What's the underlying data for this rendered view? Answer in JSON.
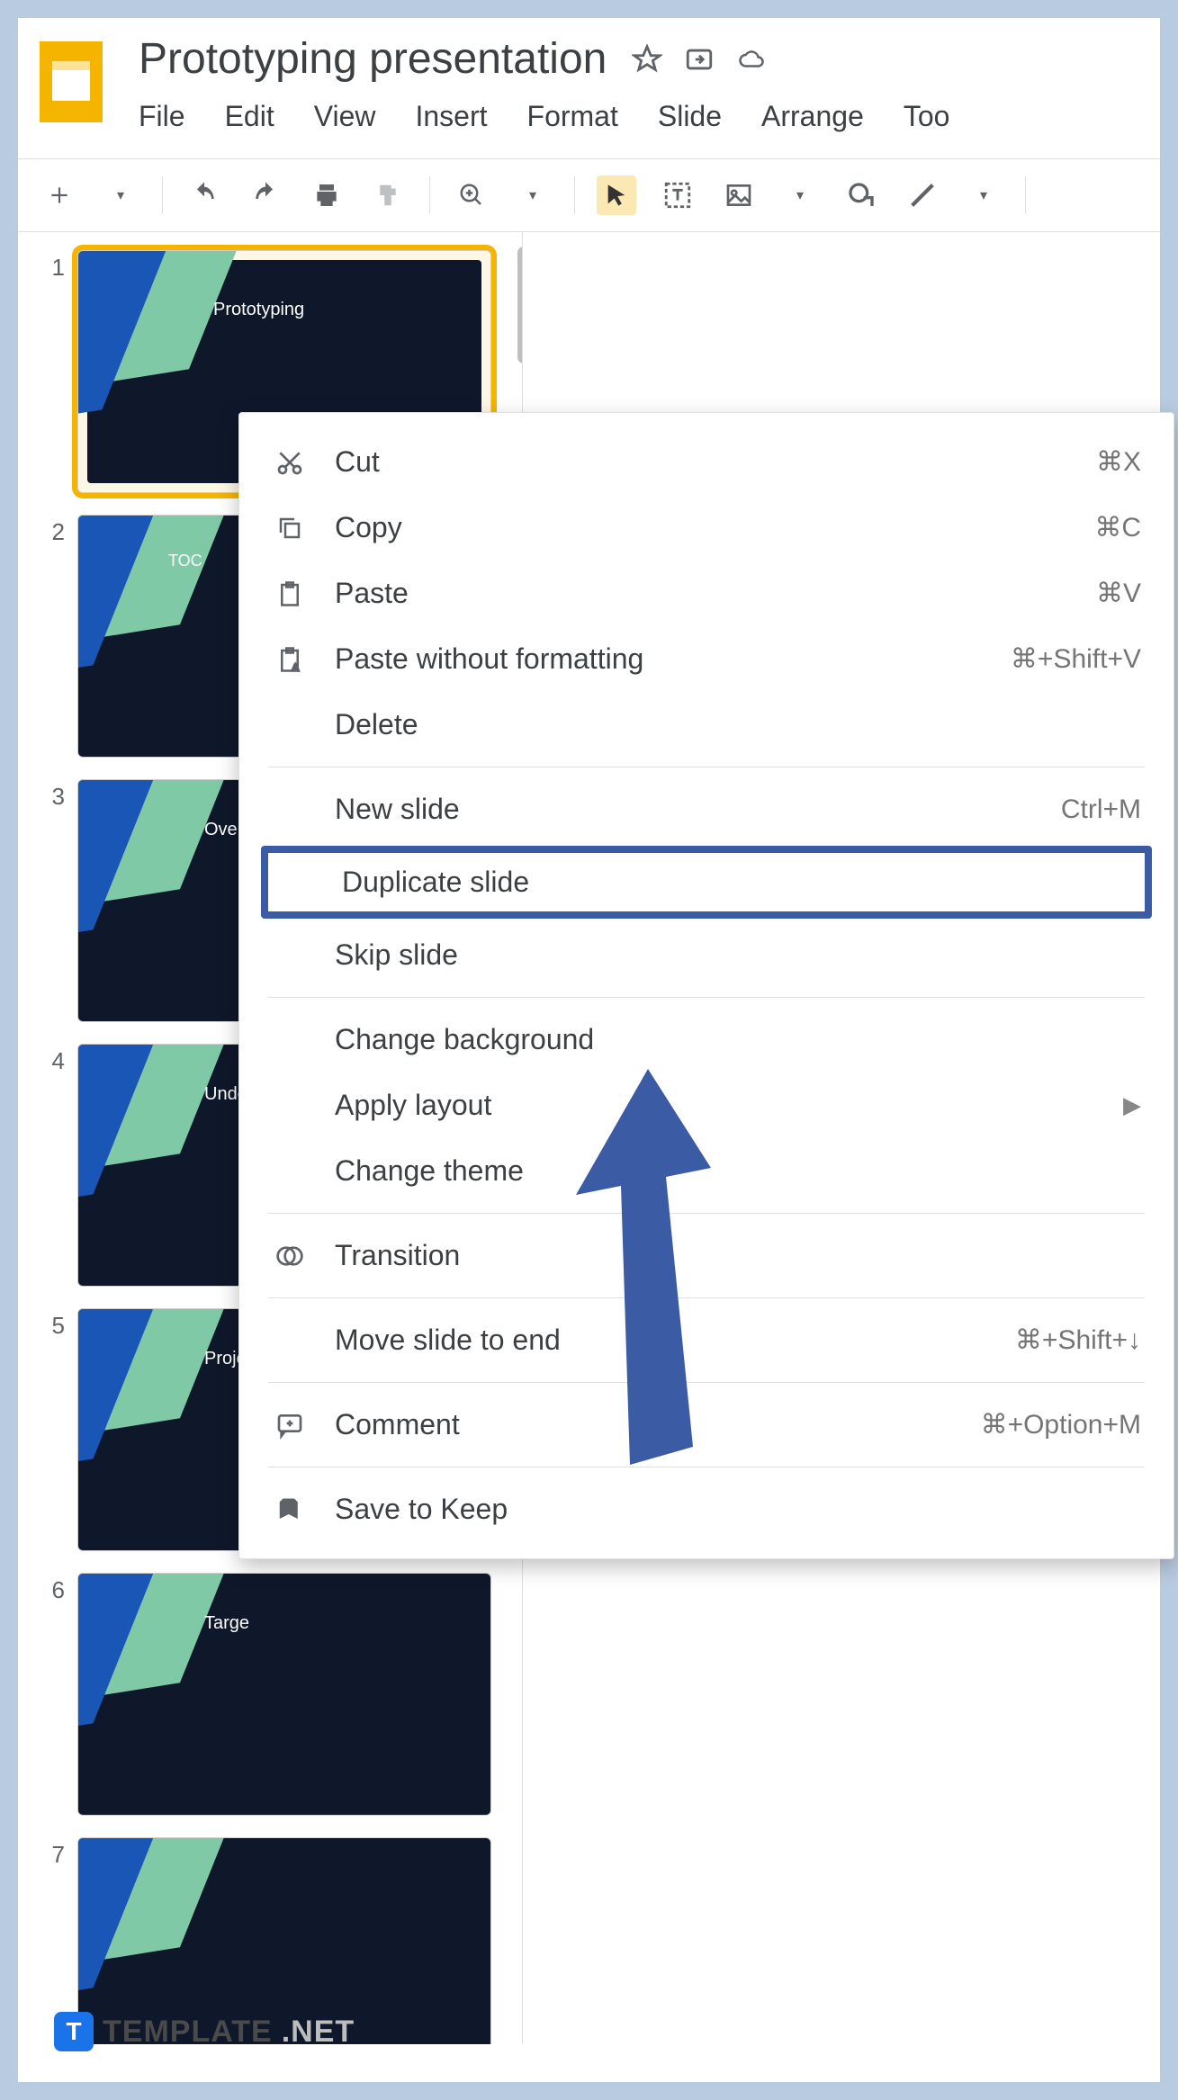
{
  "title": "Prototyping presentation",
  "menubar": [
    "File",
    "Edit",
    "View",
    "Insert",
    "Format",
    "Slide",
    "Arrange",
    "Too"
  ],
  "slides": [
    {
      "num": "1",
      "label": "Prototyping",
      "selected": true
    },
    {
      "num": "2",
      "label": "TOC"
    },
    {
      "num": "3",
      "label": "Overv"
    },
    {
      "num": "4",
      "label": "Unde"
    },
    {
      "num": "5",
      "label": "Proje"
    },
    {
      "num": "6",
      "label": "Targe"
    },
    {
      "num": "7",
      "label": ""
    }
  ],
  "context_menu": {
    "groups": [
      {
        "items": [
          {
            "icon": "cut-icon",
            "label": "Cut",
            "shortcut": "⌘X"
          },
          {
            "icon": "copy-icon",
            "label": "Copy",
            "shortcut": "⌘C"
          },
          {
            "icon": "paste-icon",
            "label": "Paste",
            "shortcut": "⌘V"
          },
          {
            "icon": "paste-plain-icon",
            "label": "Paste without formatting",
            "shortcut": "⌘+Shift+V"
          },
          {
            "icon": "",
            "label": "Delete",
            "shortcut": ""
          }
        ]
      },
      {
        "items": [
          {
            "icon": "",
            "label": "New slide",
            "shortcut": "Ctrl+M"
          },
          {
            "icon": "",
            "label": "Duplicate slide",
            "shortcut": "",
            "highlight": true
          },
          {
            "icon": "",
            "label": "Skip slide",
            "shortcut": ""
          }
        ]
      },
      {
        "items": [
          {
            "icon": "",
            "label": "Change background",
            "shortcut": ""
          },
          {
            "icon": "",
            "label": "Apply layout",
            "shortcut": "",
            "submenu": true
          },
          {
            "icon": "",
            "label": "Change theme",
            "shortcut": ""
          }
        ]
      },
      {
        "items": [
          {
            "icon": "transition-icon",
            "label": "Transition",
            "shortcut": ""
          }
        ]
      },
      {
        "items": [
          {
            "icon": "",
            "label": "Move slide to end",
            "shortcut": "⌘+Shift+↓"
          }
        ]
      },
      {
        "items": [
          {
            "icon": "comment-icon",
            "label": "Comment",
            "shortcut": "⌘+Option+M"
          }
        ]
      },
      {
        "items": [
          {
            "icon": "keep-icon",
            "label": "Save to Keep",
            "shortcut": ""
          }
        ]
      }
    ]
  },
  "watermark": {
    "brand": "TEMPLATE",
    "suffix": ".NET"
  }
}
